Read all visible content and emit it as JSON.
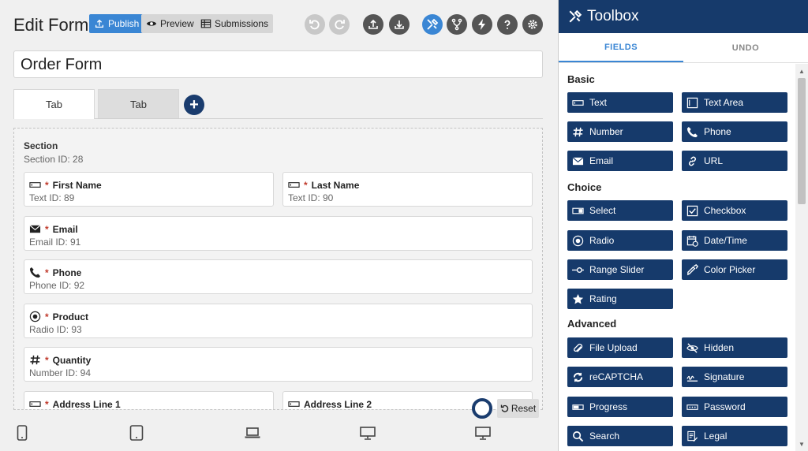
{
  "header": {
    "title": "Edit Form",
    "publish_label": "Publish",
    "preview_label": "Preview",
    "submissions_label": "Submissions"
  },
  "form": {
    "name": "Order Form"
  },
  "tabs": [
    {
      "label": "Tab"
    },
    {
      "label": "Tab"
    }
  ],
  "add_tab_label": "+",
  "section": {
    "title": "Section",
    "id_text": "Section  ID: 28"
  },
  "fields": [
    {
      "label": "First Name",
      "required": "*",
      "meta": "Text  ID: 89",
      "icon": "text-field-icon"
    },
    {
      "label": "Last Name",
      "required": "*",
      "meta": "Text  ID: 90",
      "icon": "text-field-icon"
    },
    {
      "label": "Email",
      "required": "*",
      "meta": "Email  ID: 91",
      "icon": "envelope-icon"
    },
    {
      "label": "Phone",
      "required": "*",
      "meta": "Phone  ID: 92",
      "icon": "phone-icon"
    },
    {
      "label": "Product",
      "required": "*",
      "meta": "Radio  ID: 93",
      "icon": "radio-icon"
    },
    {
      "label": "Quantity",
      "required": "*",
      "meta": "Number  ID: 94",
      "icon": "hash-icon"
    },
    {
      "label": "Address Line 1",
      "required": "*",
      "meta": "",
      "icon": "text-field-icon"
    },
    {
      "label": "Address Line 2",
      "required": "",
      "meta": "",
      "icon": "text-field-icon"
    }
  ],
  "reset_label": "Reset",
  "toolbox": {
    "title": "Toolbox",
    "tabs": [
      {
        "label": "FIELDS"
      },
      {
        "label": "UNDO"
      }
    ],
    "categories": [
      {
        "name": "Basic",
        "items": [
          "Text",
          "Text Area",
          "Number",
          "Phone",
          "Email",
          "URL"
        ]
      },
      {
        "name": "Choice",
        "items": [
          "Select",
          "Checkbox",
          "Radio",
          "Date/Time",
          "Range Slider",
          "Color Picker",
          "Rating"
        ]
      },
      {
        "name": "Advanced",
        "items": [
          "File Upload",
          "Hidden",
          "reCAPTCHA",
          "Signature",
          "Progress",
          "Password",
          "Search",
          "Legal"
        ]
      }
    ]
  },
  "colors": {
    "accent": "#3a86d4",
    "navy": "#163a6b",
    "required": "#c0392b"
  }
}
